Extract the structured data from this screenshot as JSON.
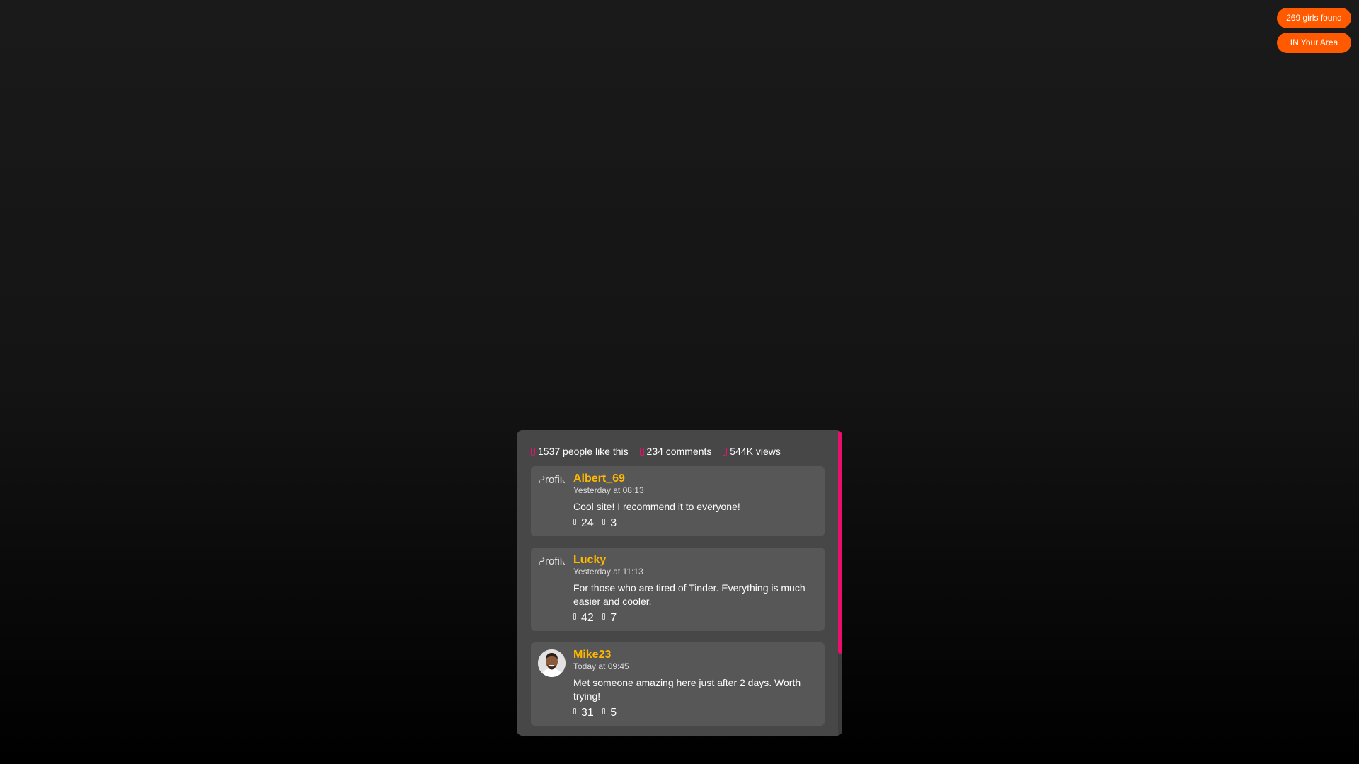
{
  "badges": {
    "girls_found": "269 girls found",
    "area": "IN Your Area"
  },
  "colors": {
    "accent_orange": "#ff5a00",
    "accent_pink": "#e8106a",
    "author_yellow": "#ffb800",
    "panel": "#474747",
    "comment_card": "#575757"
  },
  "stats": {
    "likes": "1537 people like this",
    "comments": "234 comments",
    "views": "544K views"
  },
  "comments": [
    {
      "author": "Albert_69",
      "time": "Yesterday at 08:13",
      "avatar_alt": "Profile pict",
      "text": "Cool site! I recommend it to everyone!",
      "likes": "24",
      "dislikes": "3"
    },
    {
      "author": "Lucky",
      "time": "Yesterday at 11:13",
      "avatar_alt": "Profile pict",
      "text": "For those who are tired of Tinder. Everything is much easier and cooler.",
      "likes": "42",
      "dislikes": "7"
    },
    {
      "author": "Mike23",
      "time": "Today at 09:45",
      "avatar_alt": "",
      "text": "Met someone amazing here just after 2 days. Worth trying!",
      "likes": "31",
      "dislikes": "5"
    }
  ],
  "icons": {
    "stat_likes": "heart-icon",
    "stat_comments": "comment-icon",
    "stat_views": "eye-icon",
    "react_like": "thumbs-up-icon",
    "react_dislike": "thumbs-down-icon"
  }
}
